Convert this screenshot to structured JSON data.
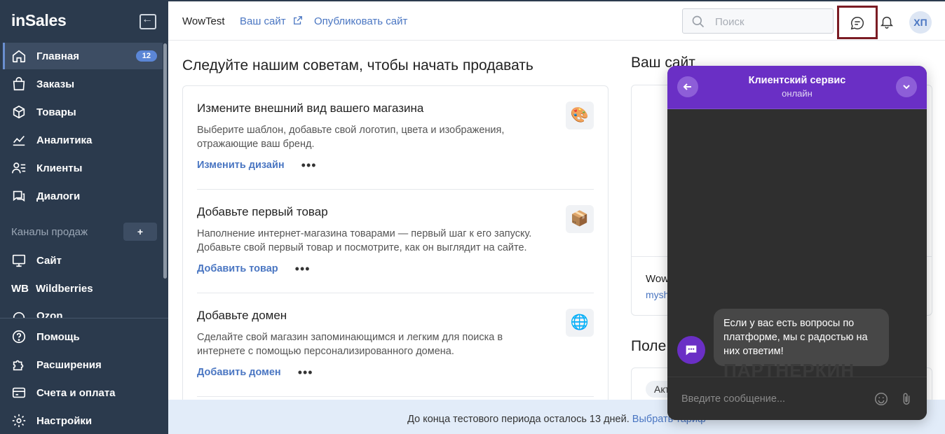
{
  "sidebar": {
    "logo": "inSales",
    "nav_top": [
      {
        "label": "Главная",
        "badge": "12",
        "icon": "home-icon"
      },
      {
        "label": "Заказы",
        "icon": "bag-icon"
      },
      {
        "label": "Товары",
        "icon": "box-icon"
      },
      {
        "label": "Аналитика",
        "icon": "chart-icon"
      },
      {
        "label": "Клиенты",
        "icon": "clients-icon"
      },
      {
        "label": "Диалоги",
        "icon": "dialogs-icon"
      }
    ],
    "channels_label": "Каналы продаж",
    "add_channel": "+",
    "channels": [
      {
        "label": "Сайт",
        "icon": "monitor-icon"
      },
      {
        "label": "Wildberries",
        "icon_text": "WB"
      },
      {
        "label": "Ozon",
        "icon": "ozon-icon"
      }
    ],
    "nav_bottom": [
      {
        "label": "Помощь",
        "icon": "help-icon"
      },
      {
        "label": "Расширения",
        "icon": "puzzle-icon"
      },
      {
        "label": "Счета и оплата",
        "icon": "card-icon"
      },
      {
        "label": "Настройки",
        "icon": "gear-icon"
      }
    ]
  },
  "header": {
    "shop_name": "WowTest",
    "your_site": "Ваш сайт",
    "publish": "Опубликовать сайт",
    "search_placeholder": "Поиск",
    "avatar": "ХП"
  },
  "main": {
    "title": "Следуйте нашим советам, чтобы начать продавать",
    "tips": [
      {
        "title": "Измените внешний вид вашего магазина",
        "desc": "Выберите шаблон, добавьте свой логотип, цвета и изображения, отражающие ваш бренд.",
        "action": "Изменить дизайн",
        "emoji": "🎨"
      },
      {
        "title": "Добавьте первый товар",
        "desc": "Наполнение интернет-магазина товарами — первый шаг к его запуску. Добавьте свой первый товар и посмотрите, как он выглядит на сайте.",
        "action": "Добавить товар",
        "emoji": "📦"
      },
      {
        "title": "Добавьте домен",
        "desc": "Сделайте свой магазин запоминающимся и легким для поиска в интернете с помощью персонализированного домена.",
        "action": "Добавить домен",
        "emoji": "🌐"
      }
    ],
    "more": "•••"
  },
  "right": {
    "title": "Ваш сайт",
    "site_name": "Wow",
    "site_url": "mysh",
    "title2": "Поле",
    "chip": "Акт"
  },
  "banner": {
    "text": "До конца тестового периода осталось 13 дней.",
    "link": "Выбрать тариф"
  },
  "chat": {
    "title": "Клиентский сервис",
    "status": "онлайн",
    "message": "Если у вас есть вопросы по платформе, мы с радостью на них ответим!",
    "input_placeholder": "Введите сообщение...",
    "watermark": "ПАРТНЕРКИН"
  }
}
